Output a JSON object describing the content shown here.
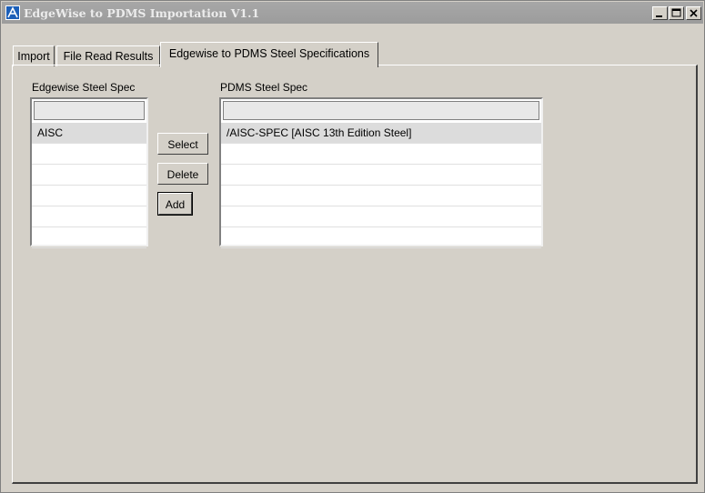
{
  "window": {
    "title": "EdgeWise to PDMS Importation V1.1"
  },
  "tabs": [
    {
      "label": "Import"
    },
    {
      "label": "File Read Results"
    },
    {
      "label": "Edgewise to PDMS Steel Specifications"
    }
  ],
  "edgewise": {
    "label": "Edgewise Steel Spec",
    "items": [
      "AISC",
      "",
      "",
      "",
      "",
      ""
    ]
  },
  "pdms": {
    "label": "PDMS Steel Spec",
    "items": [
      "/AISC-SPEC [AISC 13th Edition Steel]",
      "",
      "",
      "",
      "",
      ""
    ]
  },
  "buttons": {
    "select": "Select",
    "delete": "Delete",
    "add": "Add"
  }
}
